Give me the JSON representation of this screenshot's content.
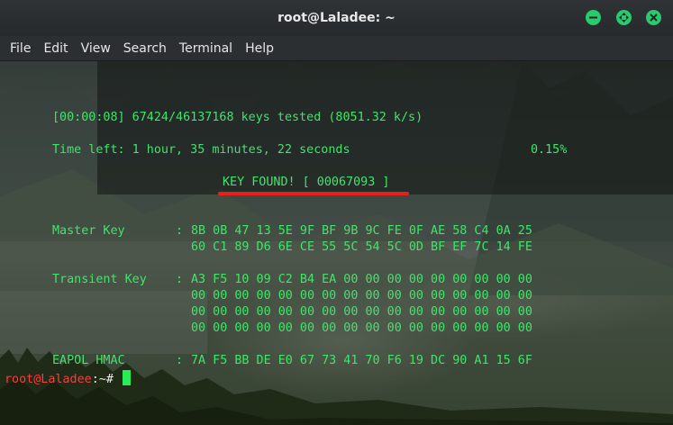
{
  "window": {
    "title": "root@Laladee: ~",
    "controls": [
      "minimize-icon",
      "maximize-icon",
      "close-icon"
    ],
    "accent": "#29c96d"
  },
  "menu": [
    "File",
    "Edit",
    "View",
    "Search",
    "Terminal",
    "Help"
  ],
  "terminal": {
    "text_color": "#43e36b",
    "progress_line": "[00:00:08] 67424/46137168 keys tested (8051.32 k/s)",
    "time_left": "Time left: 1 hour, 35 minutes, 22 seconds",
    "percent": "0.15%",
    "key_found": "KEY FOUND! [ 00067093 ]",
    "underline_color": "#ee1c1c",
    "master_key": {
      "label": "Master Key",
      "lines": [
        "8B 0B 47 13 5E 9F BF 9B 9C FE 0F AE 58 C4 0A 25",
        "60 C1 89 D6 6E CE 55 5C 54 5C 0D BF EF 7C 14 FE"
      ]
    },
    "transient_key": {
      "label": "Transient Key",
      "lines": [
        "A3 F5 10 09 C2 B4 EA 00 00 00 00 00 00 00 00 00",
        "00 00 00 00 00 00 00 00 00 00 00 00 00 00 00 00",
        "00 00 00 00 00 00 00 00 00 00 00 00 00 00 00 00",
        "00 00 00 00 00 00 00 00 00 00 00 00 00 00 00 00"
      ]
    },
    "eapol_hmac": {
      "label": "EAPOL HMAC",
      "value": "7A F5 BB DE E0 67 73 41 70 F6 19 DC 90 A1 15 6F"
    },
    "separator": ":",
    "prompt": {
      "user_host": "root@Laladee",
      "path": ":~",
      "symbol": "#",
      "user_color": "#ff3b3b"
    }
  }
}
